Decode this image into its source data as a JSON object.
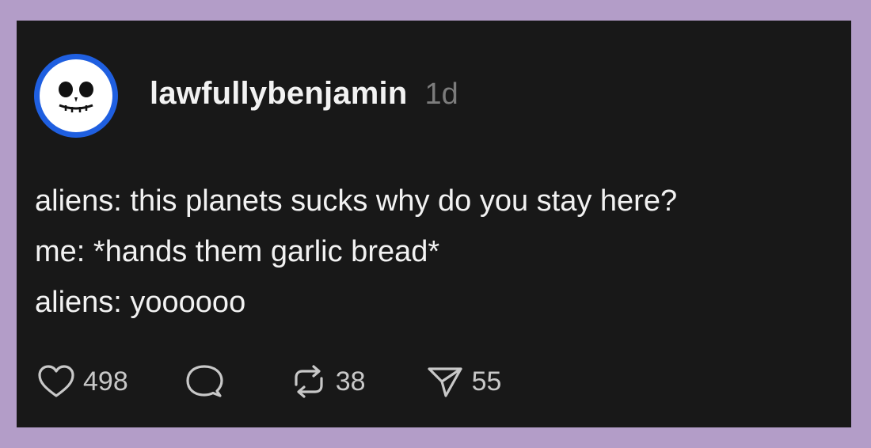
{
  "post": {
    "username": "lawfullybenjamin",
    "timestamp": "1d",
    "lines": [
      "aliens: this planets sucks why do you stay here?",
      "me: *hands them garlic bread*",
      "aliens: yoooooo"
    ]
  },
  "actions": {
    "like": {
      "icon": "heart-icon",
      "count": "498"
    },
    "reply": {
      "icon": "comment-icon",
      "count": ""
    },
    "repost": {
      "icon": "repost-icon",
      "count": "38"
    },
    "share": {
      "icon": "send-icon",
      "count": "55"
    }
  },
  "colors": {
    "background": "#b39dc8",
    "card": "#181818",
    "text": "#f2f2f2",
    "muted": "#7c7c7c",
    "avatar_ring": "#1f5fe0"
  }
}
